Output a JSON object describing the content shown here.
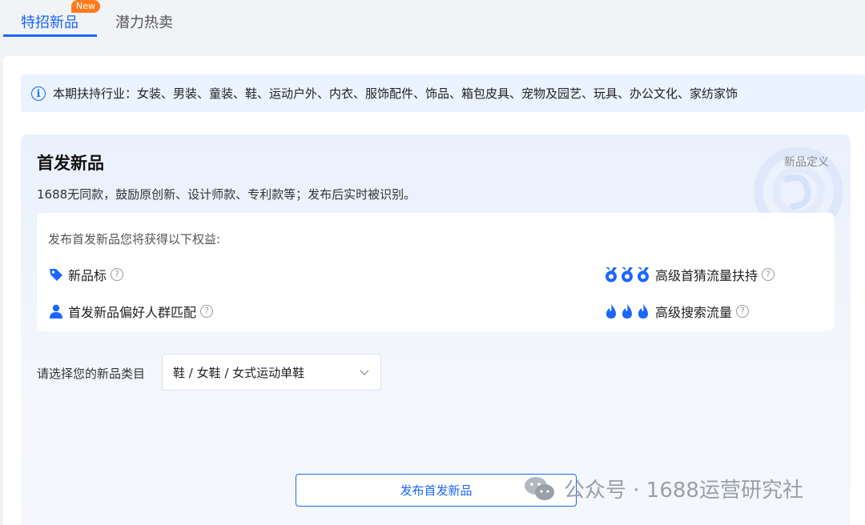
{
  "tabs": [
    {
      "label": "特招新品",
      "active": true,
      "badge": "New"
    },
    {
      "label": "潜力热卖",
      "active": false
    }
  ],
  "notice": {
    "text": "本期扶持行业：女装、男装、童装、鞋、运动户外、内衣、服饰配件、饰品、箱包皮具、宠物及园艺、玩具、办公文化、家纺家饰",
    "icon": "info-icon"
  },
  "card": {
    "title": "首发新品",
    "definition_link": "新品定义",
    "description": "1688无同款，鼓励原创新、设计师款、专利款等；发布后实时被识别。"
  },
  "benefits": {
    "title": "发布首发新品您将获得以下权益:",
    "items": [
      {
        "label": "新品标",
        "icon": "tag-icon"
      },
      {
        "label": "首发新品偏好人群匹配",
        "icon": "user-icon"
      },
      {
        "label": "高级首猜流量扶持",
        "icon": "medal-icon"
      },
      {
        "label": "高级搜索流量",
        "icon": "flame-icon"
      }
    ],
    "help_glyph": "?"
  },
  "category": {
    "label": "请选择您的新品类目",
    "selected": "鞋 / 女鞋 / 女式运动单鞋"
  },
  "publish_button": "发布首发新品",
  "watermark": "公众号 · 1688运营研究社",
  "colors": {
    "accent": "#1a66ff",
    "badge": "#ff7a1a",
    "notice_bg": "#eaf3ff"
  }
}
